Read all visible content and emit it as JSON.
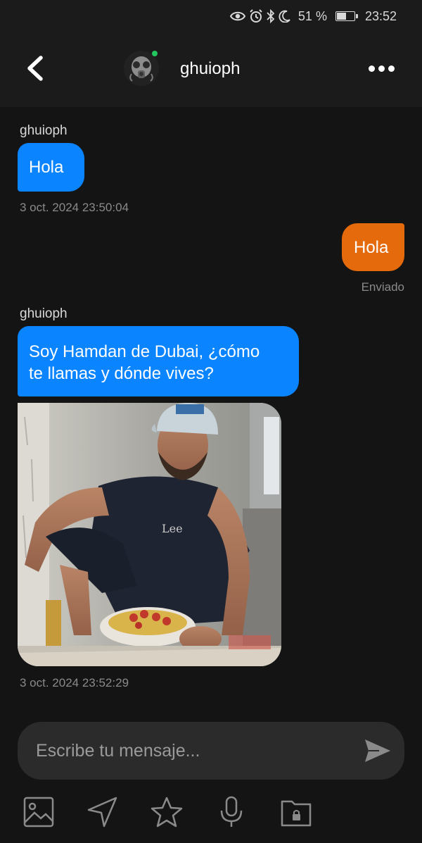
{
  "status_bar": {
    "battery_text": "51 %",
    "battery_level": 0.51,
    "time": "23:52",
    "icons": [
      "eye-icon",
      "alarm-icon",
      "bluetooth-icon",
      "moon-icon",
      "battery-icon"
    ]
  },
  "header": {
    "contact_name": "ghuioph",
    "online": true,
    "back_icon": "chevron-left-icon",
    "more_icon": "more-dots-icon"
  },
  "messages": [
    {
      "direction": "incoming",
      "sender": "ghuioph",
      "text": "Hola",
      "timestamp": "3 oct. 2024 23:50:04"
    },
    {
      "direction": "outgoing",
      "text": "Hola",
      "status": "Enviado"
    },
    {
      "direction": "incoming",
      "sender": "ghuioph",
      "text": "Soy Hamdan de Dubai, ¿cómo te llamas y dónde vives?",
      "text_line1": "Soy Hamdan de Dubai, ¿cómo",
      "text_line2": "te llamas y dónde vives?",
      "attachment": "photo",
      "timestamp": "3 oct. 2024 23:52:29"
    }
  ],
  "composer": {
    "placeholder": "Escribe tu mensaje...",
    "send_icon": "send-icon"
  },
  "toolbar": {
    "items": [
      "image-icon",
      "location-icon",
      "star-icon",
      "microphone-icon",
      "locked-folder-icon"
    ]
  },
  "colors": {
    "background": "#141414",
    "header": "#1b1b1b",
    "incoming_bubble": "#0a84ff",
    "outgoing_bubble": "#e56a0c",
    "online": "#22c55e"
  }
}
